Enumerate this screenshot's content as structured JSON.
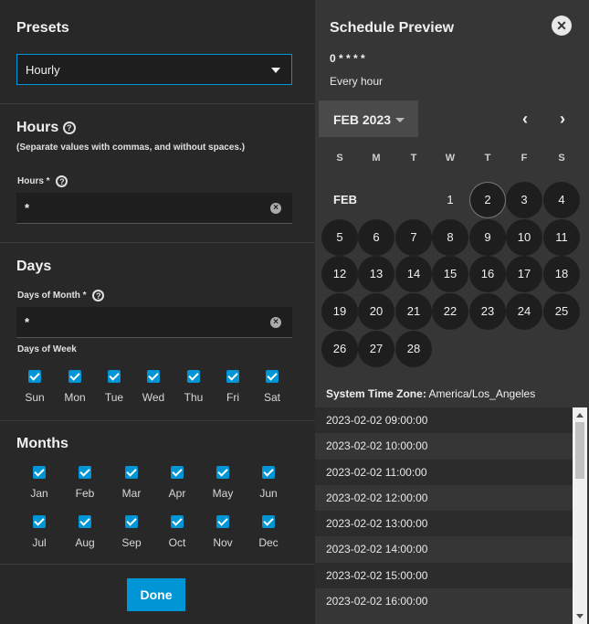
{
  "presets": {
    "title": "Presets",
    "selected": "Hourly"
  },
  "hours": {
    "title": "Hours",
    "hint": "(Separate values with commas, and without spaces.)",
    "field_label": "Hours *",
    "value": "*"
  },
  "days": {
    "title": "Days",
    "month_label": "Days of Month *",
    "month_value": "*",
    "week_label": "Days of Week",
    "weekdays": [
      "Sun",
      "Mon",
      "Tue",
      "Wed",
      "Thu",
      "Fri",
      "Sat"
    ]
  },
  "months": {
    "title": "Months",
    "row1": [
      "Jan",
      "Feb",
      "Mar",
      "Apr",
      "May",
      "Jun"
    ],
    "row2": [
      "Jul",
      "Aug",
      "Sep",
      "Oct",
      "Nov",
      "Dec"
    ]
  },
  "done_label": "Done",
  "preview": {
    "title": "Schedule Preview",
    "cron": "0 * * * *",
    "description": "Every hour",
    "month_year": "FEB 2023",
    "week_headers": [
      "S",
      "M",
      "T",
      "W",
      "T",
      "F",
      "S"
    ],
    "month_short": "FEB",
    "days": [
      "1",
      "2",
      "3",
      "4",
      "5",
      "6",
      "7",
      "8",
      "9",
      "10",
      "11",
      "12",
      "13",
      "14",
      "15",
      "16",
      "17",
      "18",
      "19",
      "20",
      "21",
      "22",
      "23",
      "24",
      "25",
      "26",
      "27",
      "28"
    ],
    "today": "2",
    "tz_label": "System Time Zone:",
    "tz_value": "America/Los_Angeles",
    "times": [
      "2023-02-02 09:00:00",
      "2023-02-02 10:00:00",
      "2023-02-02 11:00:00",
      "2023-02-02 12:00:00",
      "2023-02-02 13:00:00",
      "2023-02-02 14:00:00",
      "2023-02-02 15:00:00",
      "2023-02-02 16:00:00"
    ]
  },
  "icons": {
    "help": "help-circle-icon",
    "close": "close-icon",
    "clear": "clear-icon"
  }
}
